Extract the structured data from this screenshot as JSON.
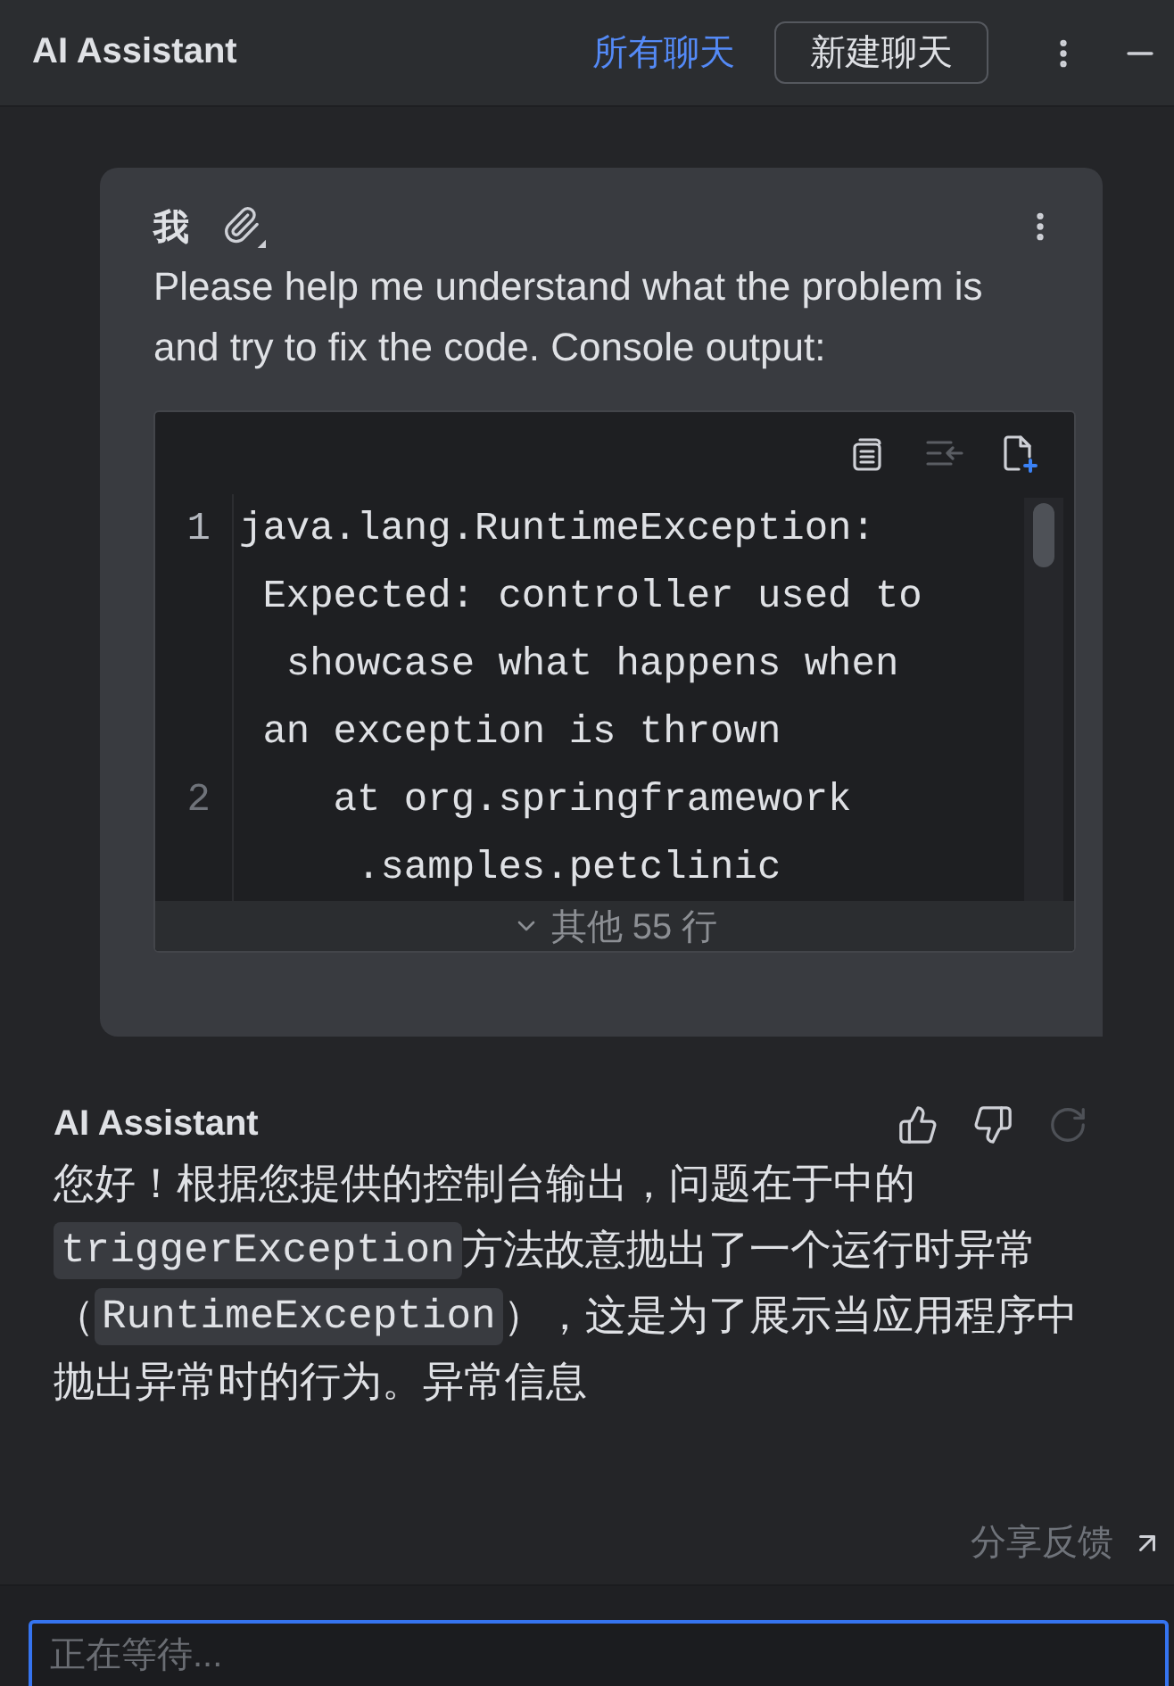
{
  "header": {
    "title": "AI Assistant",
    "all_chats_link": "所有聊天",
    "new_chat_button": "新建聊天"
  },
  "user_message": {
    "author": "我",
    "text": "Please help me understand what the problem is and try to fix the code. Console output:",
    "code_block": {
      "toolbar": [
        {
          "kind": "copy",
          "disabled": false
        },
        {
          "kind": "insert",
          "disabled": true
        },
        {
          "kind": "new_file",
          "disabled": false
        }
      ],
      "lines": [
        {
          "number": "1",
          "active": true,
          "segments": [
            "java.lang.RuntimeException:",
            " Expected: controller used to",
            "  showcase what happens when",
            " an exception is thrown"
          ]
        },
        {
          "number": "2",
          "active": false,
          "segments": [
            "    at org.springframework",
            "     .samples.petclinic"
          ]
        }
      ],
      "collapsed_lines": "其他 55 行"
    }
  },
  "assistant_message": {
    "author": "AI Assistant",
    "actions": [
      {
        "kind": "like",
        "disabled": false
      },
      {
        "kind": "dislike",
        "disabled": false
      },
      {
        "kind": "regenerate",
        "disabled": true
      }
    ],
    "lines": [
      {
        "segments": [
          {
            "kind": "text",
            "text": "您好！根据您提供的控制台输出，问题在于中的"
          }
        ]
      },
      {
        "segments": [
          {
            "kind": "code",
            "text": "triggerException"
          },
          {
            "kind": "text",
            "text": "方法故意抛出了一个运行时异常"
          }
        ]
      },
      {
        "segments": [
          {
            "kind": "text",
            "text": "（"
          },
          {
            "kind": "code",
            "text": "RuntimeException"
          },
          {
            "kind": "text",
            "text": "），这是为了展示当应用程序中"
          }
        ]
      },
      {
        "segments": [
          {
            "kind": "text",
            "text": "抛出异常时的行为。异常信息"
          }
        ]
      }
    ]
  },
  "feedback_link": "分享反馈",
  "input": {
    "placeholder": "正在等待...",
    "focused": true
  }
}
